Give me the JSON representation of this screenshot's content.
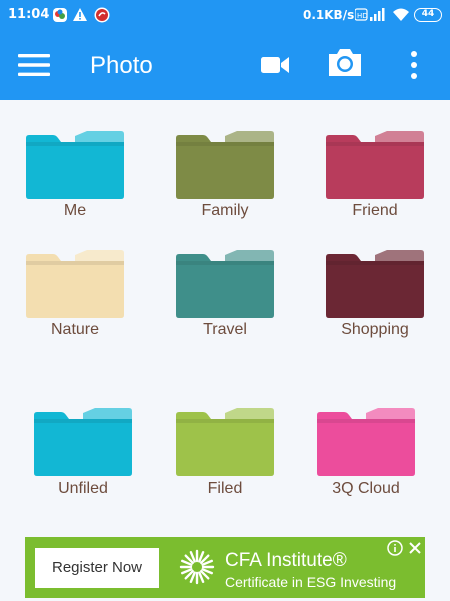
{
  "status_bar": {
    "time": "11:04",
    "network_speed": "0.1KB/s",
    "battery": "44"
  },
  "app_bar": {
    "title": "Photo"
  },
  "folders": [
    {
      "label": "Me",
      "color": "#12b7d4"
    },
    {
      "label": "Family",
      "color": "#7e8b46"
    },
    {
      "label": "Friend",
      "color": "#b83c5c"
    },
    {
      "label": "Nature",
      "color": "#f3deb0"
    },
    {
      "label": "Travel",
      "color": "#3f8f8a"
    },
    {
      "label": "Shopping",
      "color": "#6b2734"
    },
    {
      "label": "Unfiled",
      "color": "#12b7d4"
    },
    {
      "label": "Filed",
      "color": "#9ec24a"
    },
    {
      "label": "3Q Cloud",
      "color": "#ec4d9c"
    }
  ],
  "ad": {
    "button_label": "Register Now",
    "brand": "CFA Institute®",
    "subtitle": "Certificate in ESG Investing",
    "background_color": "#7bbd2f"
  },
  "colors": {
    "primary": "#2196f3",
    "label_text": "#6d4c3d"
  }
}
